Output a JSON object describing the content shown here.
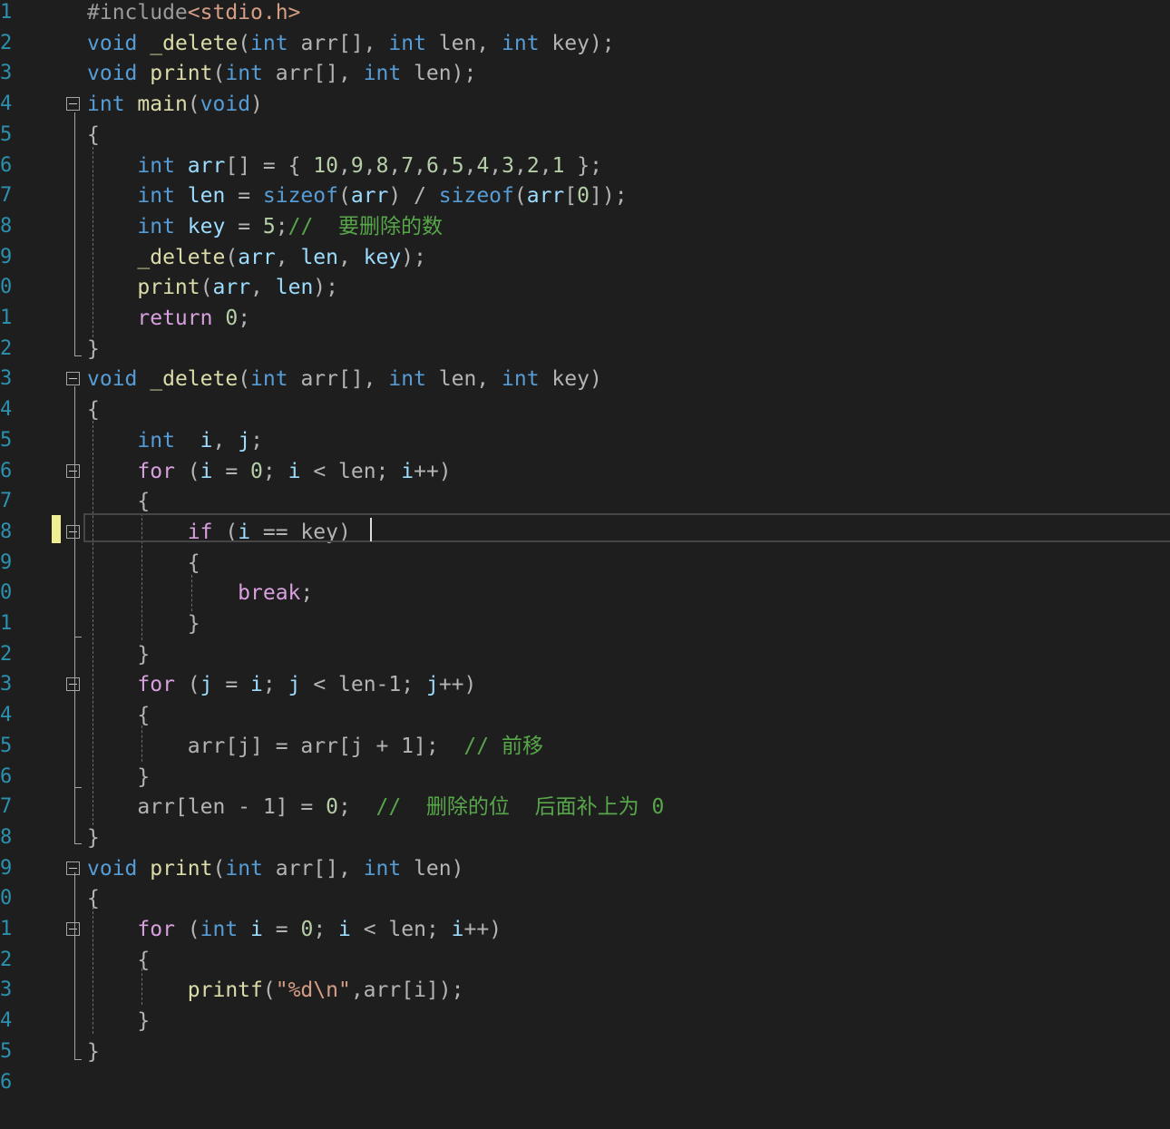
{
  "editor": {
    "line_numbers": [
      "1",
      "2",
      "3",
      "4",
      "5",
      "6",
      "7",
      "8",
      "9",
      "0",
      "1",
      "2",
      "3",
      "4",
      "5",
      "6",
      "7",
      "8",
      "9",
      "0",
      "1",
      "2",
      "3",
      "4",
      "5",
      "6",
      "7",
      "8",
      "9",
      "0",
      "1",
      "2",
      "3",
      "4",
      "5",
      "6"
    ],
    "current_line_index": 17,
    "lines": [
      [
        {
          "t": "#include",
          "c": "pre"
        },
        {
          "t": "<stdio.h>",
          "c": "inc"
        }
      ],
      [
        {
          "t": "void",
          "c": "kw"
        },
        {
          "t": " ",
          "c": "plain"
        },
        {
          "t": "_delete",
          "c": "fn"
        },
        {
          "t": "(",
          "c": "op"
        },
        {
          "t": "int",
          "c": "kw"
        },
        {
          "t": " arr[], ",
          "c": "op"
        },
        {
          "t": "int",
          "c": "kw"
        },
        {
          "t": " len, ",
          "c": "op"
        },
        {
          "t": "int",
          "c": "kw"
        },
        {
          "t": " key);",
          "c": "op"
        }
      ],
      [
        {
          "t": "void",
          "c": "kw"
        },
        {
          "t": " ",
          "c": "plain"
        },
        {
          "t": "print",
          "c": "fn"
        },
        {
          "t": "(",
          "c": "op"
        },
        {
          "t": "int",
          "c": "kw"
        },
        {
          "t": " arr[], ",
          "c": "op"
        },
        {
          "t": "int",
          "c": "kw"
        },
        {
          "t": " len);",
          "c": "op"
        }
      ],
      [
        {
          "t": "int",
          "c": "kw"
        },
        {
          "t": " ",
          "c": "plain"
        },
        {
          "t": "main",
          "c": "fn"
        },
        {
          "t": "(",
          "c": "op"
        },
        {
          "t": "void",
          "c": "kw"
        },
        {
          "t": ")",
          "c": "op"
        }
      ],
      [
        {
          "t": "{",
          "c": "op"
        }
      ],
      [
        {
          "t": "    ",
          "c": "plain"
        },
        {
          "t": "int",
          "c": "kw"
        },
        {
          "t": " ",
          "c": "plain"
        },
        {
          "t": "arr",
          "c": "var"
        },
        {
          "t": "[] = { ",
          "c": "op"
        },
        {
          "t": "10",
          "c": "num"
        },
        {
          "t": ",",
          "c": "op"
        },
        {
          "t": "9",
          "c": "num"
        },
        {
          "t": ",",
          "c": "op"
        },
        {
          "t": "8",
          "c": "num"
        },
        {
          "t": ",",
          "c": "op"
        },
        {
          "t": "7",
          "c": "num"
        },
        {
          "t": ",",
          "c": "op"
        },
        {
          "t": "6",
          "c": "num"
        },
        {
          "t": ",",
          "c": "op"
        },
        {
          "t": "5",
          "c": "num"
        },
        {
          "t": ",",
          "c": "op"
        },
        {
          "t": "4",
          "c": "num"
        },
        {
          "t": ",",
          "c": "op"
        },
        {
          "t": "3",
          "c": "num"
        },
        {
          "t": ",",
          "c": "op"
        },
        {
          "t": "2",
          "c": "num"
        },
        {
          "t": ",",
          "c": "op"
        },
        {
          "t": "1",
          "c": "num"
        },
        {
          "t": " };",
          "c": "op"
        }
      ],
      [
        {
          "t": "    ",
          "c": "plain"
        },
        {
          "t": "int",
          "c": "kw"
        },
        {
          "t": " ",
          "c": "plain"
        },
        {
          "t": "len",
          "c": "var"
        },
        {
          "t": " = ",
          "c": "op"
        },
        {
          "t": "sizeof",
          "c": "kw"
        },
        {
          "t": "(",
          "c": "op"
        },
        {
          "t": "arr",
          "c": "var"
        },
        {
          "t": ") / ",
          "c": "op"
        },
        {
          "t": "sizeof",
          "c": "kw"
        },
        {
          "t": "(",
          "c": "op"
        },
        {
          "t": "arr",
          "c": "var"
        },
        {
          "t": "[",
          "c": "op"
        },
        {
          "t": "0",
          "c": "num"
        },
        {
          "t": "]);",
          "c": "op"
        }
      ],
      [
        {
          "t": "    ",
          "c": "plain"
        },
        {
          "t": "int",
          "c": "kw"
        },
        {
          "t": " ",
          "c": "plain"
        },
        {
          "t": "key",
          "c": "var"
        },
        {
          "t": " = ",
          "c": "op"
        },
        {
          "t": "5",
          "c": "num"
        },
        {
          "t": ";",
          "c": "op"
        },
        {
          "t": "//  要删除的数",
          "c": "cmt"
        }
      ],
      [
        {
          "t": "    ",
          "c": "plain"
        },
        {
          "t": "_delete",
          "c": "fn"
        },
        {
          "t": "(",
          "c": "op"
        },
        {
          "t": "arr",
          "c": "var"
        },
        {
          "t": ", ",
          "c": "op"
        },
        {
          "t": "len",
          "c": "var"
        },
        {
          "t": ", ",
          "c": "op"
        },
        {
          "t": "key",
          "c": "var"
        },
        {
          "t": ");",
          "c": "op"
        }
      ],
      [
        {
          "t": "    ",
          "c": "plain"
        },
        {
          "t": "print",
          "c": "fn"
        },
        {
          "t": "(",
          "c": "op"
        },
        {
          "t": "arr",
          "c": "var"
        },
        {
          "t": ", ",
          "c": "op"
        },
        {
          "t": "len",
          "c": "var"
        },
        {
          "t": ");",
          "c": "op"
        }
      ],
      [
        {
          "t": "    ",
          "c": "plain"
        },
        {
          "t": "return",
          "c": "ctl"
        },
        {
          "t": " ",
          "c": "plain"
        },
        {
          "t": "0",
          "c": "num"
        },
        {
          "t": ";",
          "c": "op"
        }
      ],
      [
        {
          "t": "}",
          "c": "op"
        }
      ],
      [
        {
          "t": "void",
          "c": "kw"
        },
        {
          "t": " ",
          "c": "plain"
        },
        {
          "t": "_delete",
          "c": "fn"
        },
        {
          "t": "(",
          "c": "op"
        },
        {
          "t": "int",
          "c": "kw"
        },
        {
          "t": " arr[], ",
          "c": "op"
        },
        {
          "t": "int",
          "c": "kw"
        },
        {
          "t": " len, ",
          "c": "op"
        },
        {
          "t": "int",
          "c": "kw"
        },
        {
          "t": " key)",
          "c": "op"
        }
      ],
      [
        {
          "t": "{",
          "c": "op"
        }
      ],
      [
        {
          "t": "    ",
          "c": "plain"
        },
        {
          "t": "int",
          "c": "kw"
        },
        {
          "t": "  ",
          "c": "plain"
        },
        {
          "t": "i",
          "c": "var"
        },
        {
          "t": ", ",
          "c": "op"
        },
        {
          "t": "j",
          "c": "var"
        },
        {
          "t": ";",
          "c": "op"
        }
      ],
      [
        {
          "t": "    ",
          "c": "plain"
        },
        {
          "t": "for",
          "c": "ctl"
        },
        {
          "t": " (",
          "c": "op"
        },
        {
          "t": "i",
          "c": "var"
        },
        {
          "t": " = ",
          "c": "op"
        },
        {
          "t": "0",
          "c": "num"
        },
        {
          "t": "; ",
          "c": "op"
        },
        {
          "t": "i",
          "c": "var"
        },
        {
          "t": " < len; ",
          "c": "op"
        },
        {
          "t": "i",
          "c": "var"
        },
        {
          "t": "++)",
          "c": "op"
        }
      ],
      [
        {
          "t": "    {",
          "c": "op"
        }
      ],
      [
        {
          "t": "        ",
          "c": "plain"
        },
        {
          "t": "if",
          "c": "ctl"
        },
        {
          "t": " (",
          "c": "op"
        },
        {
          "t": "i",
          "c": "var"
        },
        {
          "t": " == key)",
          "c": "op"
        }
      ],
      [
        {
          "t": "        {",
          "c": "op"
        }
      ],
      [
        {
          "t": "            ",
          "c": "plain"
        },
        {
          "t": "break",
          "c": "ctl"
        },
        {
          "t": ";",
          "c": "op"
        }
      ],
      [
        {
          "t": "        }",
          "c": "op"
        }
      ],
      [
        {
          "t": "    }",
          "c": "op"
        }
      ],
      [
        {
          "t": "    ",
          "c": "plain"
        },
        {
          "t": "for",
          "c": "ctl"
        },
        {
          "t": " (",
          "c": "op"
        },
        {
          "t": "j",
          "c": "var"
        },
        {
          "t": " = ",
          "c": "op"
        },
        {
          "t": "i",
          "c": "var"
        },
        {
          "t": "; ",
          "c": "op"
        },
        {
          "t": "j",
          "c": "var"
        },
        {
          "t": " < len-1; ",
          "c": "op"
        },
        {
          "t": "j",
          "c": "var"
        },
        {
          "t": "++)",
          "c": "op"
        }
      ],
      [
        {
          "t": "    {",
          "c": "op"
        }
      ],
      [
        {
          "t": "        arr[j] = arr[j + 1];  ",
          "c": "op"
        },
        {
          "t": "// 前移",
          "c": "cmt"
        }
      ],
      [
        {
          "t": "    }",
          "c": "op"
        }
      ],
      [
        {
          "t": "    arr[len - 1] = ",
          "c": "op"
        },
        {
          "t": "0",
          "c": "num"
        },
        {
          "t": ";  ",
          "c": "op"
        },
        {
          "t": "//  删除的位  后面补上为 0",
          "c": "cmt"
        }
      ],
      [
        {
          "t": "}",
          "c": "op"
        }
      ],
      [
        {
          "t": "void",
          "c": "kw"
        },
        {
          "t": " ",
          "c": "plain"
        },
        {
          "t": "print",
          "c": "fn"
        },
        {
          "t": "(",
          "c": "op"
        },
        {
          "t": "int",
          "c": "kw"
        },
        {
          "t": " arr[], ",
          "c": "op"
        },
        {
          "t": "int",
          "c": "kw"
        },
        {
          "t": " len)",
          "c": "op"
        }
      ],
      [
        {
          "t": "{",
          "c": "op"
        }
      ],
      [
        {
          "t": "    ",
          "c": "plain"
        },
        {
          "t": "for",
          "c": "ctl"
        },
        {
          "t": " (",
          "c": "op"
        },
        {
          "t": "int",
          "c": "kw"
        },
        {
          "t": " ",
          "c": "plain"
        },
        {
          "t": "i",
          "c": "var"
        },
        {
          "t": " = ",
          "c": "op"
        },
        {
          "t": "0",
          "c": "num"
        },
        {
          "t": "; ",
          "c": "op"
        },
        {
          "t": "i",
          "c": "var"
        },
        {
          "t": " < len; ",
          "c": "op"
        },
        {
          "t": "i",
          "c": "var"
        },
        {
          "t": "++)",
          "c": "op"
        }
      ],
      [
        {
          "t": "    {",
          "c": "op"
        }
      ],
      [
        {
          "t": "        ",
          "c": "plain"
        },
        {
          "t": "printf",
          "c": "fn"
        },
        {
          "t": "(",
          "c": "op"
        },
        {
          "t": "\"%d\\n\"",
          "c": "str"
        },
        {
          "t": ",arr[i]);",
          "c": "op"
        }
      ],
      [
        {
          "t": "    }",
          "c": "op"
        }
      ],
      [
        {
          "t": "}",
          "c": "op"
        }
      ],
      []
    ],
    "fold_lines": [
      3,
      12,
      15,
      17,
      22,
      28,
      30
    ],
    "colors": {
      "background": "#1e1e1e",
      "keyword": "#569cd6",
      "control": "#d8a0df",
      "function": "#dcdcaa",
      "variable": "#9cdcfe",
      "number": "#b5cea8",
      "string": "#d69d85",
      "comment": "#57a64a",
      "line_number": "#2b91af",
      "change_marker": "#efef91"
    }
  }
}
